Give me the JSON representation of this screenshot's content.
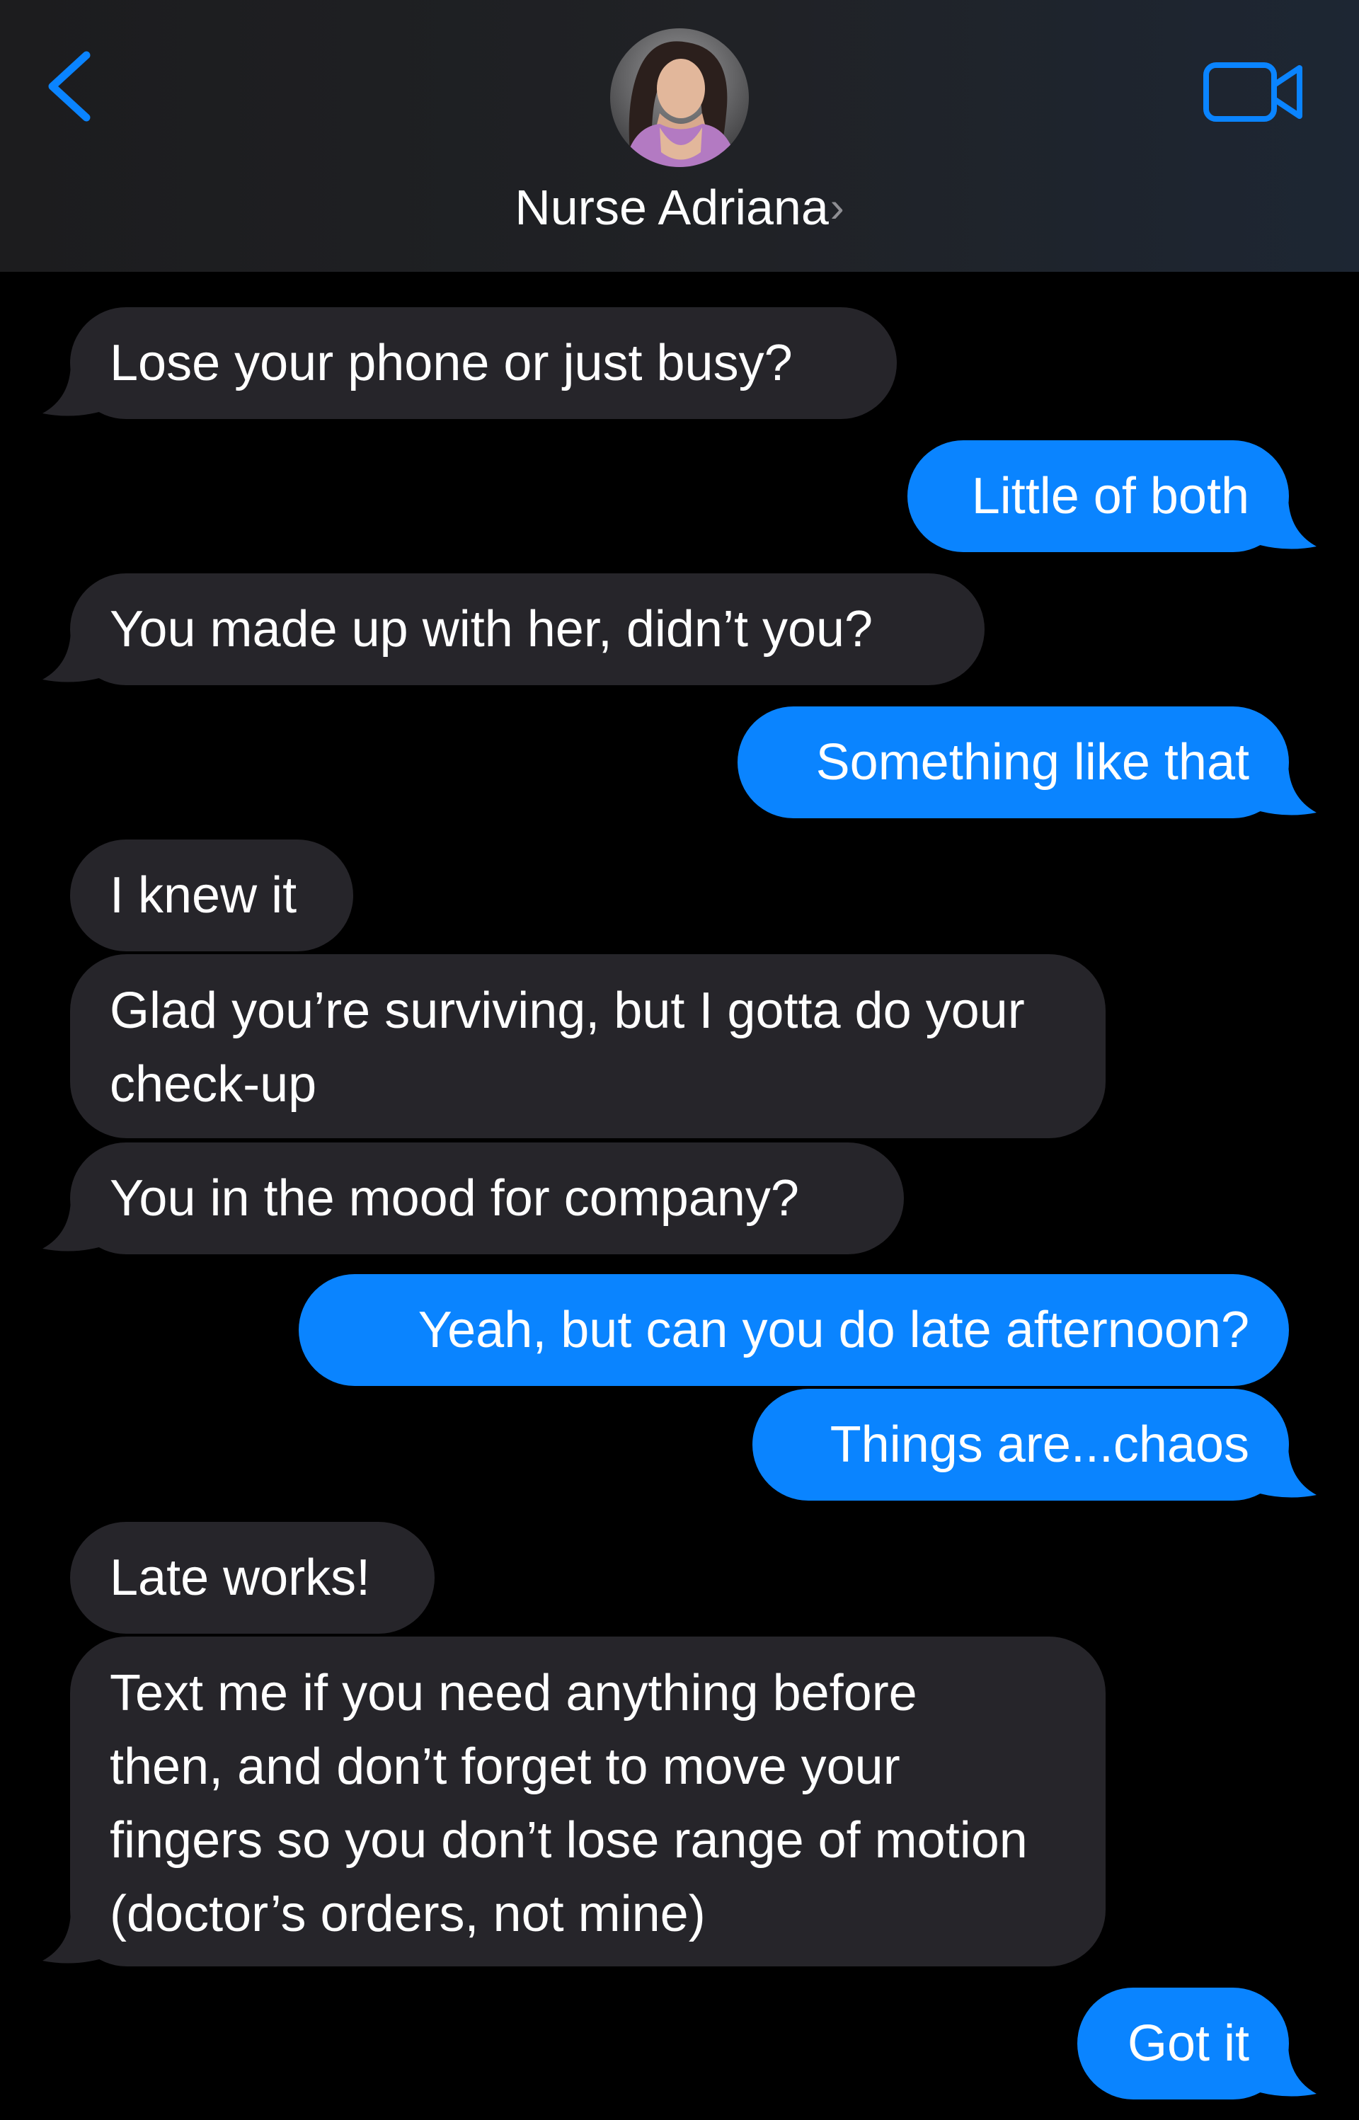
{
  "header": {
    "contact_name": "Nurse Adriana",
    "chevron": "›",
    "back_icon": "chevron-left-icon",
    "video_icon": "video-camera-icon",
    "accent_color": "#0a84ff"
  },
  "messages": [
    {
      "direction": "in",
      "text": "Lose your phone or just busy?"
    },
    {
      "direction": "out",
      "text": "Little of both"
    },
    {
      "direction": "in",
      "text": "You made up with her, didn’t you?"
    },
    {
      "direction": "out",
      "text": "Something like that"
    },
    {
      "direction": "in",
      "text": "I knew it"
    },
    {
      "direction": "in",
      "text": "Glad you’re surviving, but I gotta do your check-up"
    },
    {
      "direction": "in",
      "text": "You in the mood for company?"
    },
    {
      "direction": "out",
      "text": "Yeah, but can you do late afternoon?"
    },
    {
      "direction": "out",
      "text": "Things are...chaos"
    },
    {
      "direction": "in",
      "text": "Late works!"
    },
    {
      "direction": "in",
      "text": "Text me if you need anything before then, and don’t forget to move your fingers so you don’t lose range of motion (doctor’s orders, not mine)"
    },
    {
      "direction": "out",
      "text": "Got it"
    }
  ],
  "colors": {
    "incoming_bubble": "#26252a",
    "outgoing_bubble": "#0a84ff",
    "background": "#000000"
  }
}
